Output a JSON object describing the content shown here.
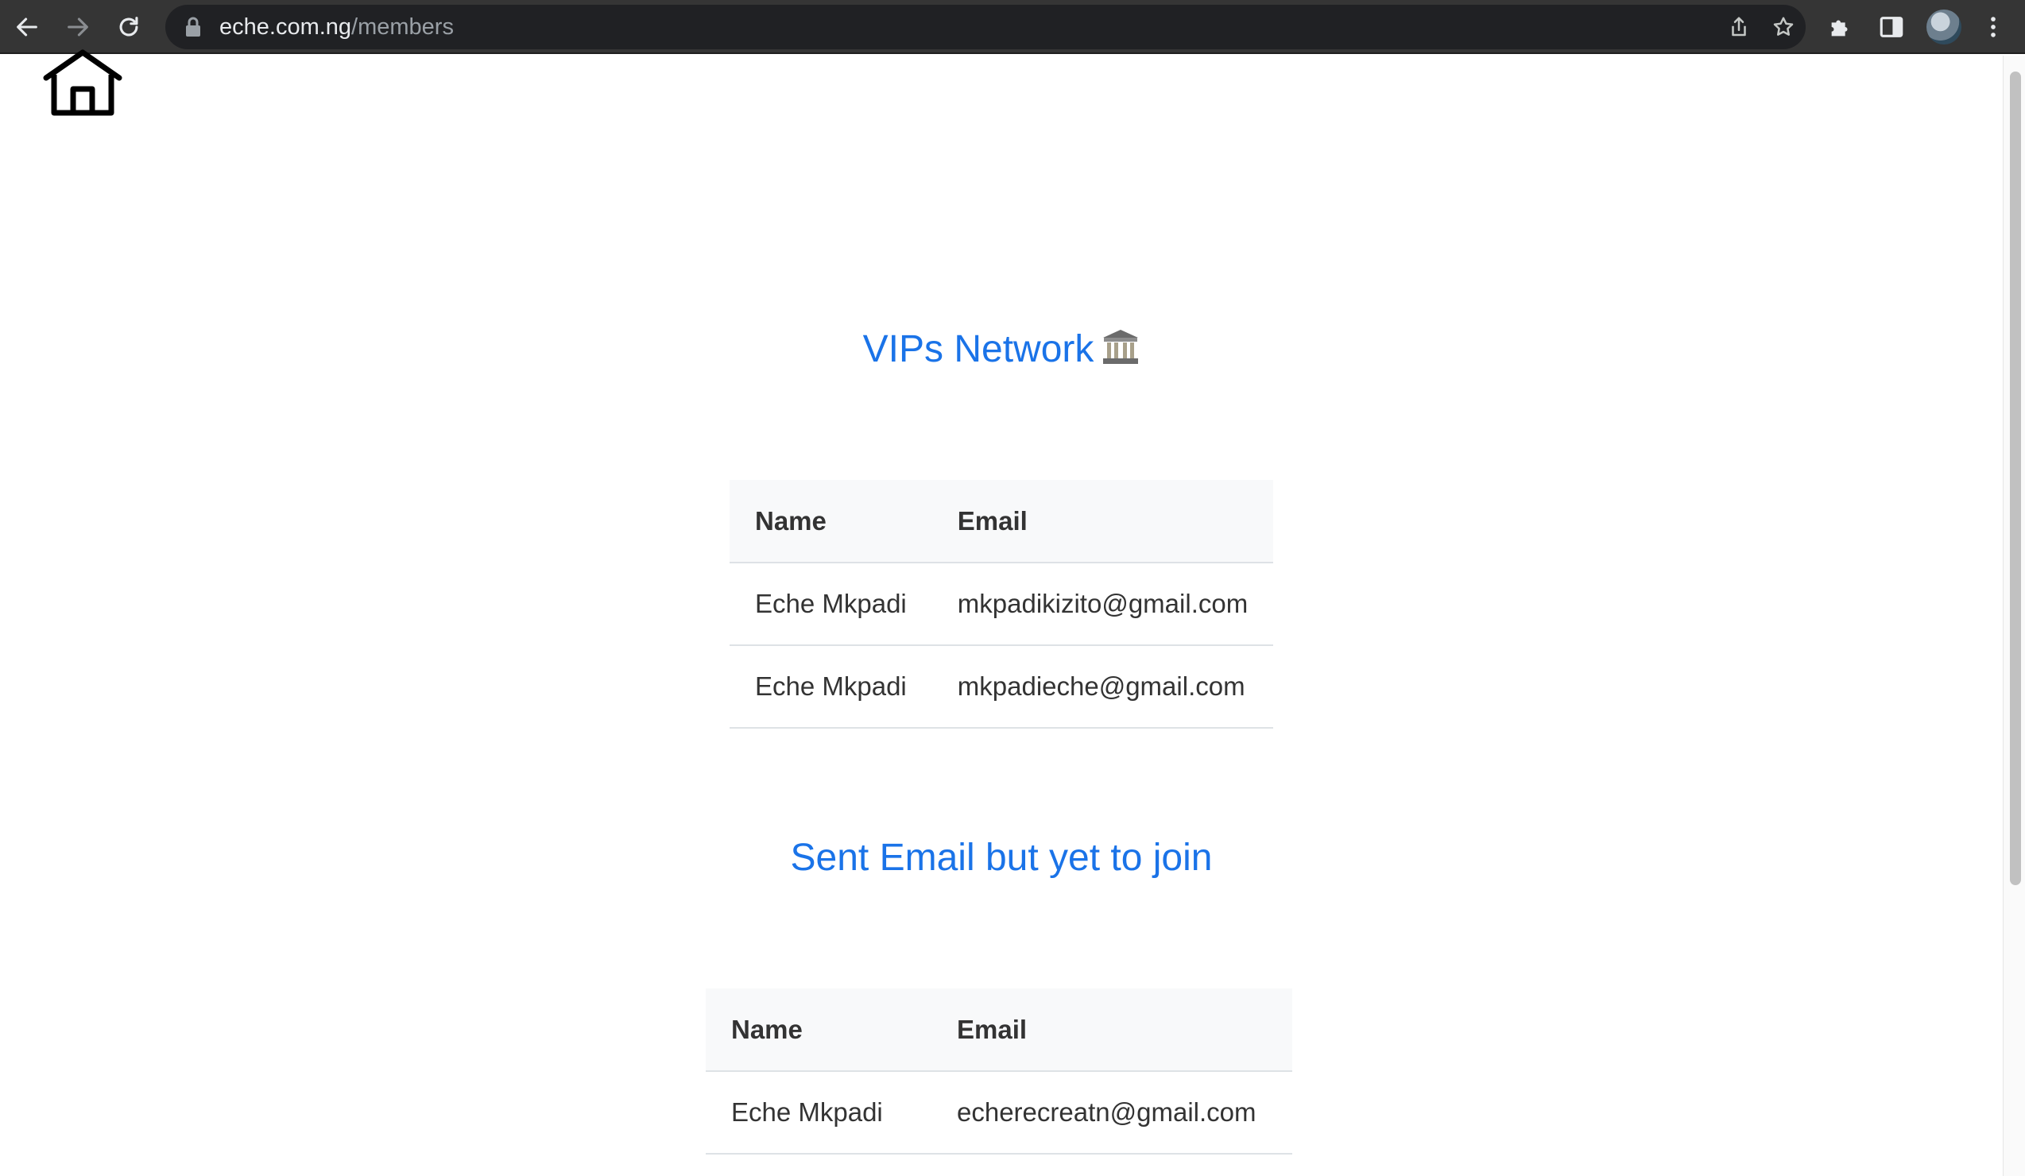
{
  "browser": {
    "url_domain": "eche.com.ng",
    "url_path": "/members",
    "icons": [
      "back-arrow-icon",
      "forward-arrow-icon",
      "reload-icon",
      "lock-icon",
      "share-icon",
      "bookmark-star-icon",
      "extensions-puzzle-icon",
      "side-panel-icon",
      "profile-avatar",
      "more-menu-icon"
    ]
  },
  "page": {
    "home_icon": "home-icon",
    "vip_section": {
      "title": "VIPs Network",
      "title_emoji": "classical-building-icon",
      "columns": [
        "Name",
        "Email"
      ],
      "rows": [
        {
          "name": "Eche Mkpadi",
          "email": "mkpadikizito@gmail.com"
        },
        {
          "name": "Eche Mkpadi",
          "email": "mkpadieche@gmail.com"
        }
      ]
    },
    "pending_section": {
      "title": "Sent Email but yet to join",
      "columns": [
        "Name",
        "Email"
      ],
      "rows": [
        {
          "name": "Eche Mkpadi",
          "email": "echerecreatn@gmail.com"
        }
      ]
    }
  },
  "colors": {
    "heading": "#1a73e8",
    "table_text": "#333333",
    "table_header_bg": "#f8f9fa",
    "toolbar_bg": "#353535"
  }
}
